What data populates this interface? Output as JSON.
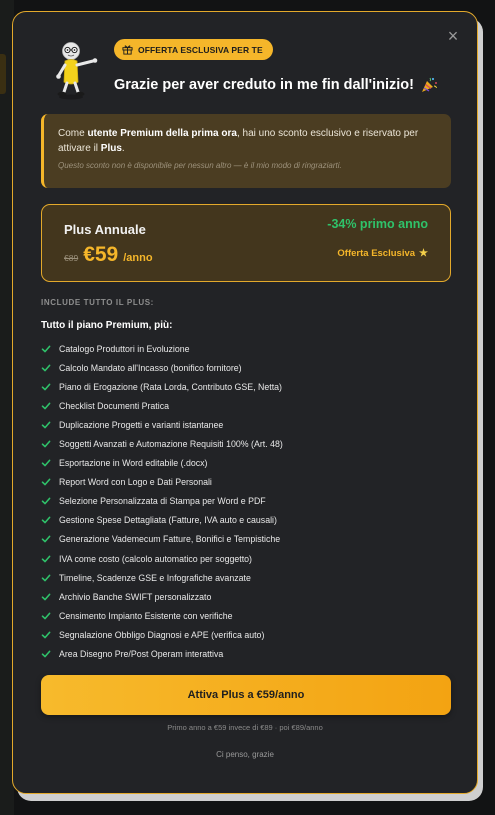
{
  "modal": {
    "close_symbol": "×",
    "badge_label": "OFFERTA ESCLUSIVA PER TE",
    "headline": "Grazie per aver creduto in me fin dall'inizio!",
    "notice": {
      "prefix": "Come ",
      "bold1": "utente Premium della prima ora",
      "middle": ", hai uno sconto esclusivo e riservato per attivare il ",
      "bold2": "Plus",
      "suffix": ".",
      "subtext": "Questo sconto non è disponibile per nessun altro — è il mio modo di ringraziarti."
    },
    "plan": {
      "name": "Plus Annuale",
      "old_price": "€89",
      "price": "€59",
      "period": "/anno",
      "discount": "-34% primo anno",
      "exclusive_label": "Offerta Esclusiva",
      "star": "★"
    },
    "includes_label": "INCLUDE TUTTO IL PLUS:",
    "features_title": "Tutto il piano Premium, più:",
    "features": [
      "Catalogo Produttori in Evoluzione",
      "Calcolo Mandato all'Incasso (bonifico fornitore)",
      "Piano di Erogazione (Rata Lorda, Contributo GSE, Netta)",
      "Checklist Documenti Pratica",
      "Duplicazione Progetti e varianti istantanee",
      "Soggetti Avanzati e Automazione Requisiti 100% (Art. 48)",
      "Esportazione in Word editabile (.docx)",
      "Report Word con Logo e Dati Personali",
      "Selezione Personalizzata di Stampa per Word e PDF",
      "Gestione Spese Dettagliata (Fatture, IVA auto e causali)",
      "Generazione Vademecum Fatture, Bonifici e Tempistiche",
      "IVA come costo (calcolo automatico per soggetto)",
      "Timeline, Scadenze GSE e Infografiche avanzate",
      "Archivio Banche SWIFT personalizzato",
      "Censimento Impianto Esistente con verifiche",
      "Segnalazione Obbligo Diagnosi e APE (verifica auto)",
      "Area Disegno Pre/Post Operam interattiva"
    ],
    "cta_label": "Attiva Plus a €59/anno",
    "fineprint": "Primo anno a €59 invece di €89 · poi €89/anno",
    "decline_label": "Ci penso, grazie"
  },
  "colors": {
    "accent": "#f5b62a",
    "success": "#2fc26a",
    "modal_bg": "#222326",
    "notice_bg": "#4b3d22",
    "plan_bg": "#43361d"
  },
  "icons": {
    "close": "close-icon",
    "badge": "gift-icon",
    "headline": "party-popper-icon",
    "feature": "check-icon",
    "mascot": "mascot-illustration"
  }
}
